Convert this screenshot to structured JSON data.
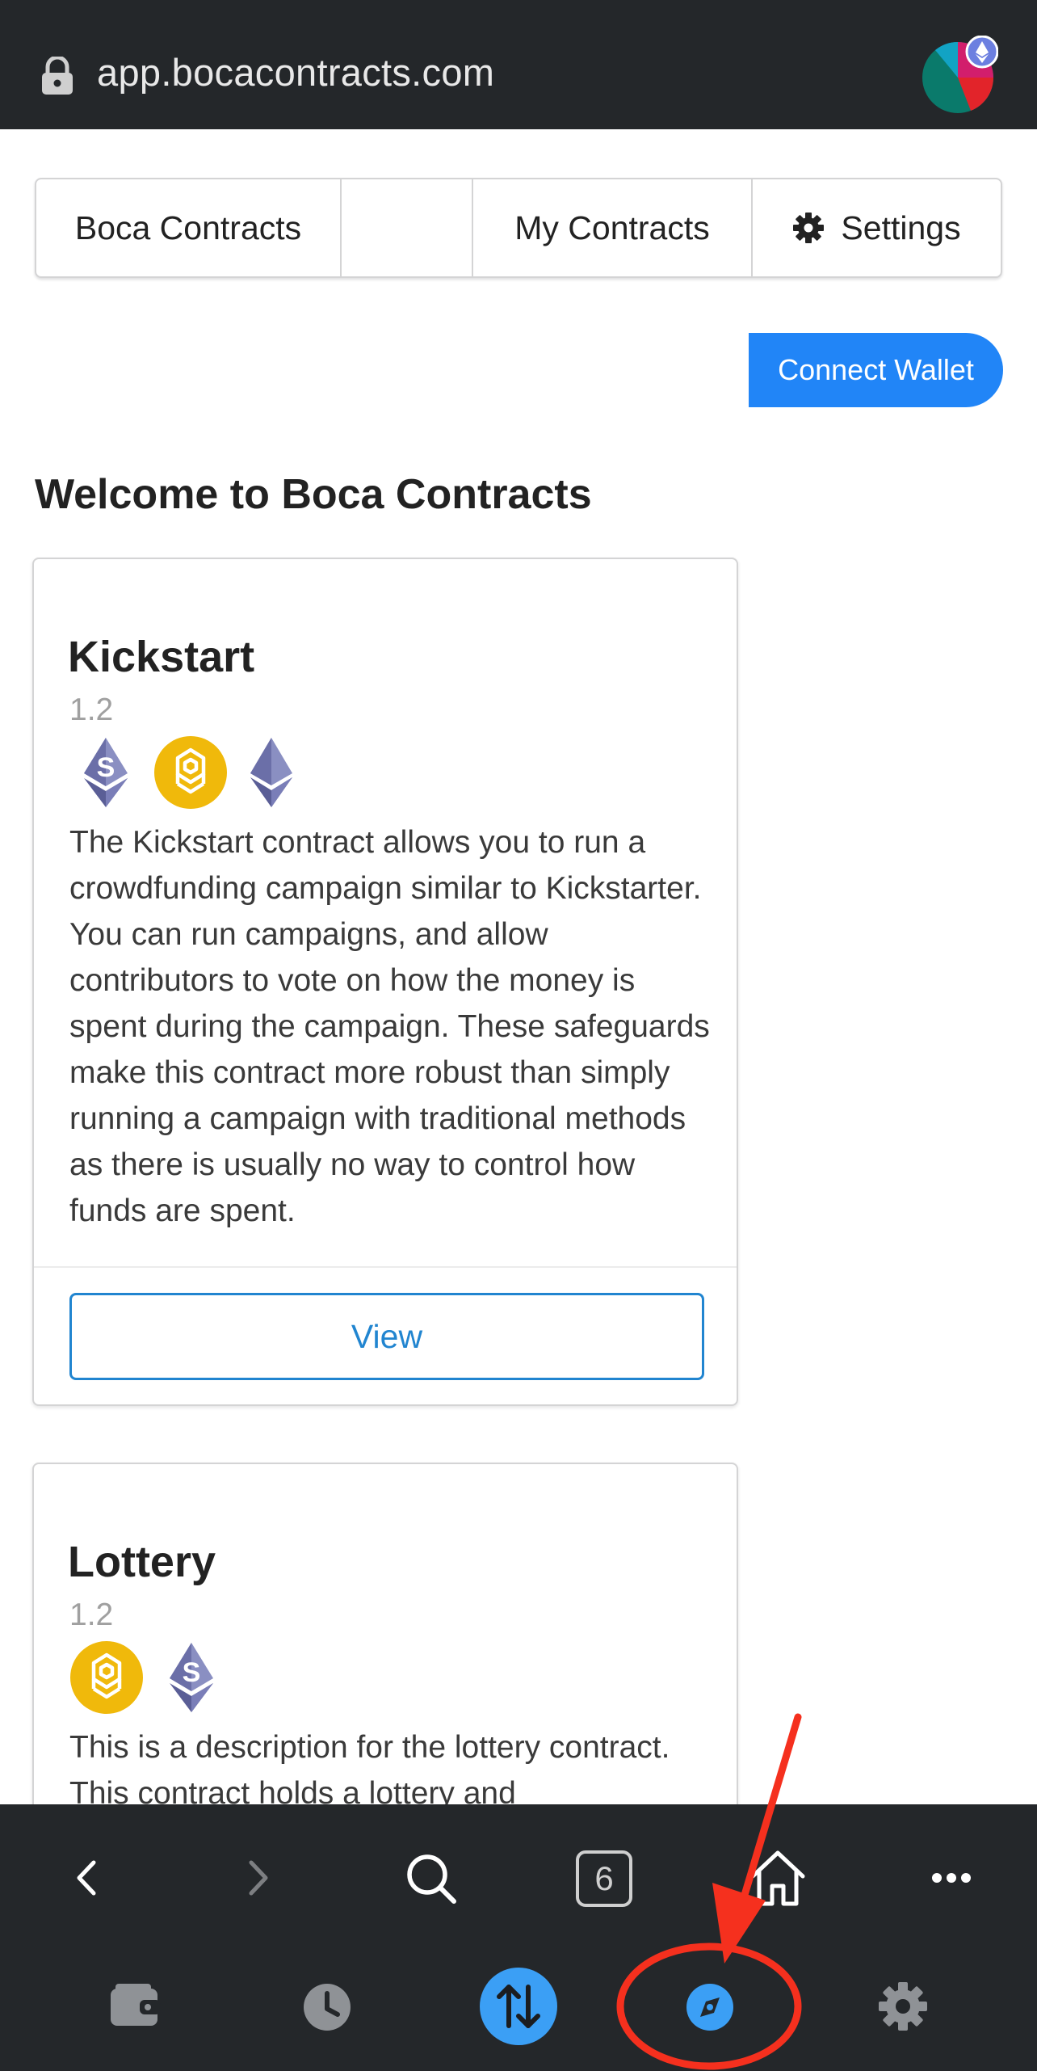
{
  "browser": {
    "url": "app.bocacontracts.com"
  },
  "nav": {
    "brand": "Boca Contracts",
    "blank": "",
    "my_contracts": "My Contracts",
    "settings": "Settings"
  },
  "connect_wallet": "Connect Wallet",
  "welcome": "Welcome to Boca Contracts",
  "contracts": [
    {
      "title": "Kickstart",
      "version": "1.2",
      "chains": [
        "ethereum-s-icon",
        "bnb-icon",
        "ethereum-icon"
      ],
      "description": "The Kickstart contract allows you to run a crowdfunding campaign similar to Kickstarter. You can run campaigns, and allow contributors to vote on how the money is spent during the campaign. These safeguards make this contract more robust than simply running a campaign with traditional methods as there is usually no way to control how funds are spent.",
      "button": "View"
    },
    {
      "title": "Lottery",
      "version": "1.2",
      "chains": [
        "bnb-icon",
        "ethereum-s-icon"
      ],
      "description": "This is a description for the lottery contract. This contract holds a lottery and"
    }
  ],
  "toolbar": {
    "tab_count": "6",
    "icons": [
      "back-icon",
      "forward-icon",
      "search-icon",
      "tabs-icon",
      "home-icon",
      "more-icon",
      "wallet-icon",
      "history-icon",
      "swap-icon",
      "browser-compass-icon",
      "settings-gear-icon"
    ]
  },
  "colors": {
    "primary_blue": "#2185f7",
    "view_blue": "#2185d0",
    "bar_dark": "#24272a",
    "annotation_red": "#f5301e",
    "bnb_yellow": "#f0b90b",
    "eth_purple": "#6b6fa8"
  }
}
